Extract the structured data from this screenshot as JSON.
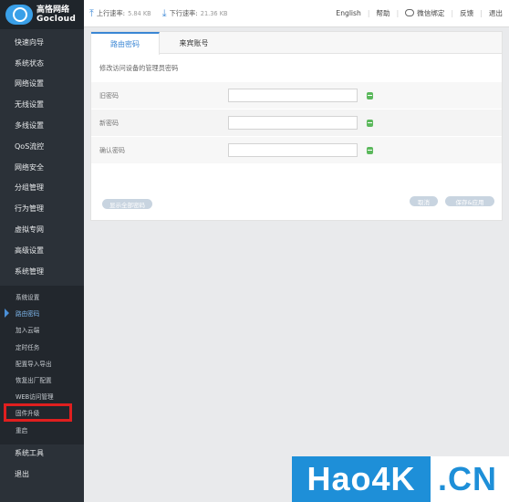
{
  "brand": {
    "name_cn": "高恪网络",
    "name_en": "Gocloud"
  },
  "topbar": {
    "upload_label": "上行速率:",
    "upload_value": "5.84 KB",
    "download_label": "下行速率:",
    "download_value": "21.36 KB",
    "links": [
      "English",
      "帮助",
      "微信绑定",
      "反馈",
      "退出"
    ]
  },
  "sidebar": {
    "items": [
      "快速向导",
      "系统状态",
      "网络设置",
      "无线设置",
      "多线设置",
      "QoS流控",
      "网络安全",
      "分组管理",
      "行为管理",
      "虚拟专网",
      "高级设置",
      "系统管理"
    ],
    "subitems": [
      "系统设置",
      "路由密码",
      "加入云端",
      "定时任务",
      "配置导入导出",
      "恢复出厂配置",
      "WEB访问管理",
      "固件升级",
      "重启"
    ],
    "bottom_items": [
      "系统工具",
      "退出"
    ]
  },
  "panel": {
    "tabs": [
      "路由密码",
      "来宾账号"
    ],
    "description": "修改访问设备的管理员密码",
    "fields": [
      {
        "label": "旧密码",
        "value": ""
      },
      {
        "label": "新密码",
        "value": ""
      },
      {
        "label": "确认密码",
        "value": ""
      }
    ],
    "button_left": "显示全部密码",
    "button_cancel": "取消",
    "button_save": "保存&应用"
  },
  "watermark": {
    "left": "Hao4K",
    "right": ".CN"
  }
}
